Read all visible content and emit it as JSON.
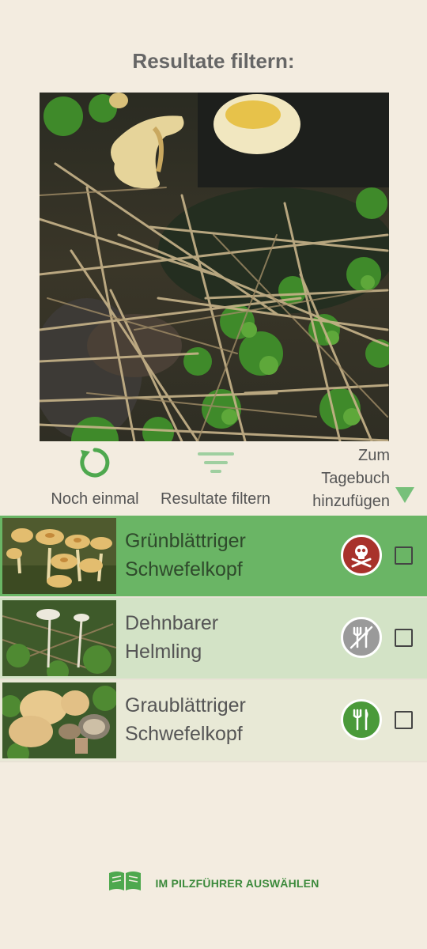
{
  "header": {
    "title": "Resultate filtern:"
  },
  "actions": {
    "again": {
      "label": "Noch einmal",
      "icon": "refresh-icon"
    },
    "filter": {
      "label": "Resultate filtern",
      "icon": "filter-icon"
    },
    "diary": {
      "line1": "Zum",
      "line2": "Tagebuch",
      "line3": "hinzufügen",
      "icon": "triangle-down-icon"
    }
  },
  "results": [
    {
      "line1": "Grünblättriger",
      "line2": "Schwefelkopf",
      "edibility": "poisonous",
      "icon": "skull-icon",
      "color": "#a8322b"
    },
    {
      "line1": "Dehnbarer",
      "line2": "Helmling",
      "edibility": "inedible",
      "icon": "crossed-cutlery-icon",
      "color": "#9a9a9a"
    },
    {
      "line1": "Graublättriger",
      "line2": "Schwefelkopf",
      "edibility": "edible",
      "icon": "cutlery-icon",
      "color": "#4a9a3a"
    }
  ],
  "footer": {
    "label": "IM PILZFÜHRER AUSWÄHLEN",
    "icon": "book-icon"
  },
  "colors": {
    "accent": "#6ab565",
    "background": "#f3ece0"
  }
}
